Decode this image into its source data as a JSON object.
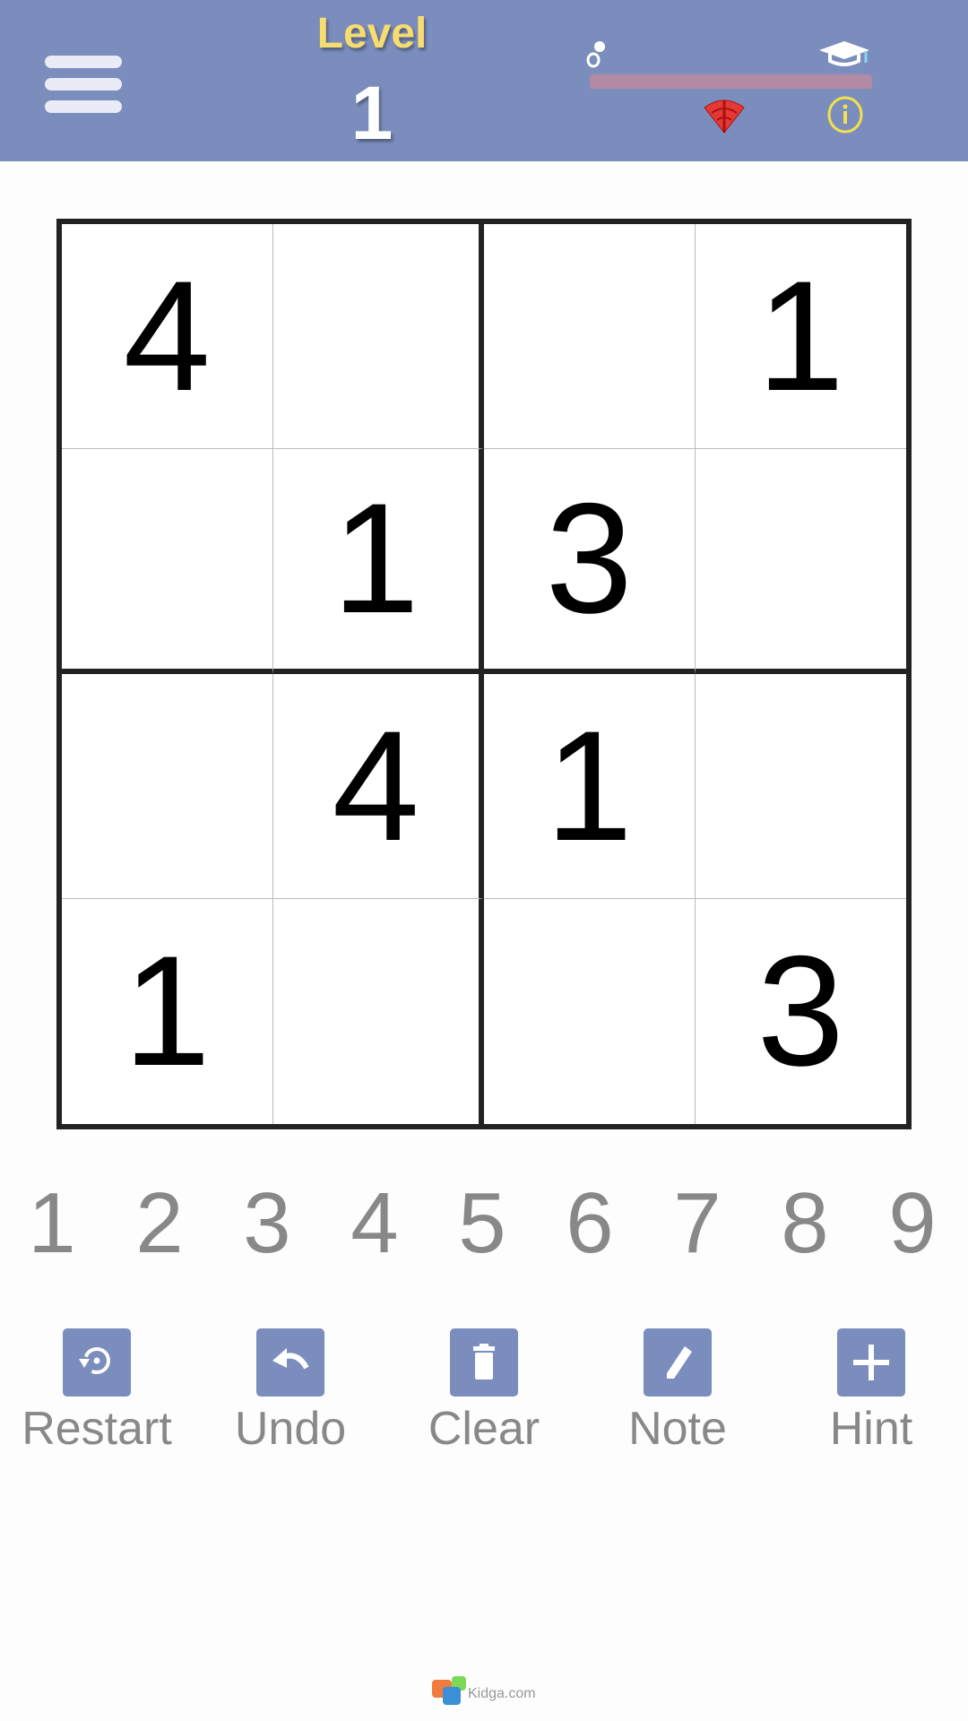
{
  "header": {
    "level_label": "Level",
    "level_value": "1",
    "progress": 0,
    "icons": [
      "menu-icon",
      "pacifier-icon",
      "graduation-cap-icon",
      "wifi-off-icon",
      "info-icon"
    ],
    "colors": {
      "bar": "#7b8dbd",
      "level_label": "#f7dc6f"
    }
  },
  "board": {
    "cells": [
      [
        "4",
        "",
        "",
        "1"
      ],
      [
        "",
        "1",
        "3",
        ""
      ],
      [
        "",
        "4",
        "1",
        ""
      ],
      [
        "1",
        "",
        "",
        "3"
      ]
    ]
  },
  "number_pad": [
    "1",
    "2",
    "3",
    "4",
    "5",
    "6",
    "7",
    "8",
    "9"
  ],
  "tools": [
    {
      "label": "Restart",
      "icon": "restart-icon"
    },
    {
      "label": "Undo",
      "icon": "undo-icon"
    },
    {
      "label": "Clear",
      "icon": "trash-icon"
    },
    {
      "label": "Note",
      "icon": "pencil-icon"
    },
    {
      "label": "Hint",
      "icon": "plus-icon"
    }
  ],
  "footer": {
    "logo_text": "Kidga.com games"
  }
}
